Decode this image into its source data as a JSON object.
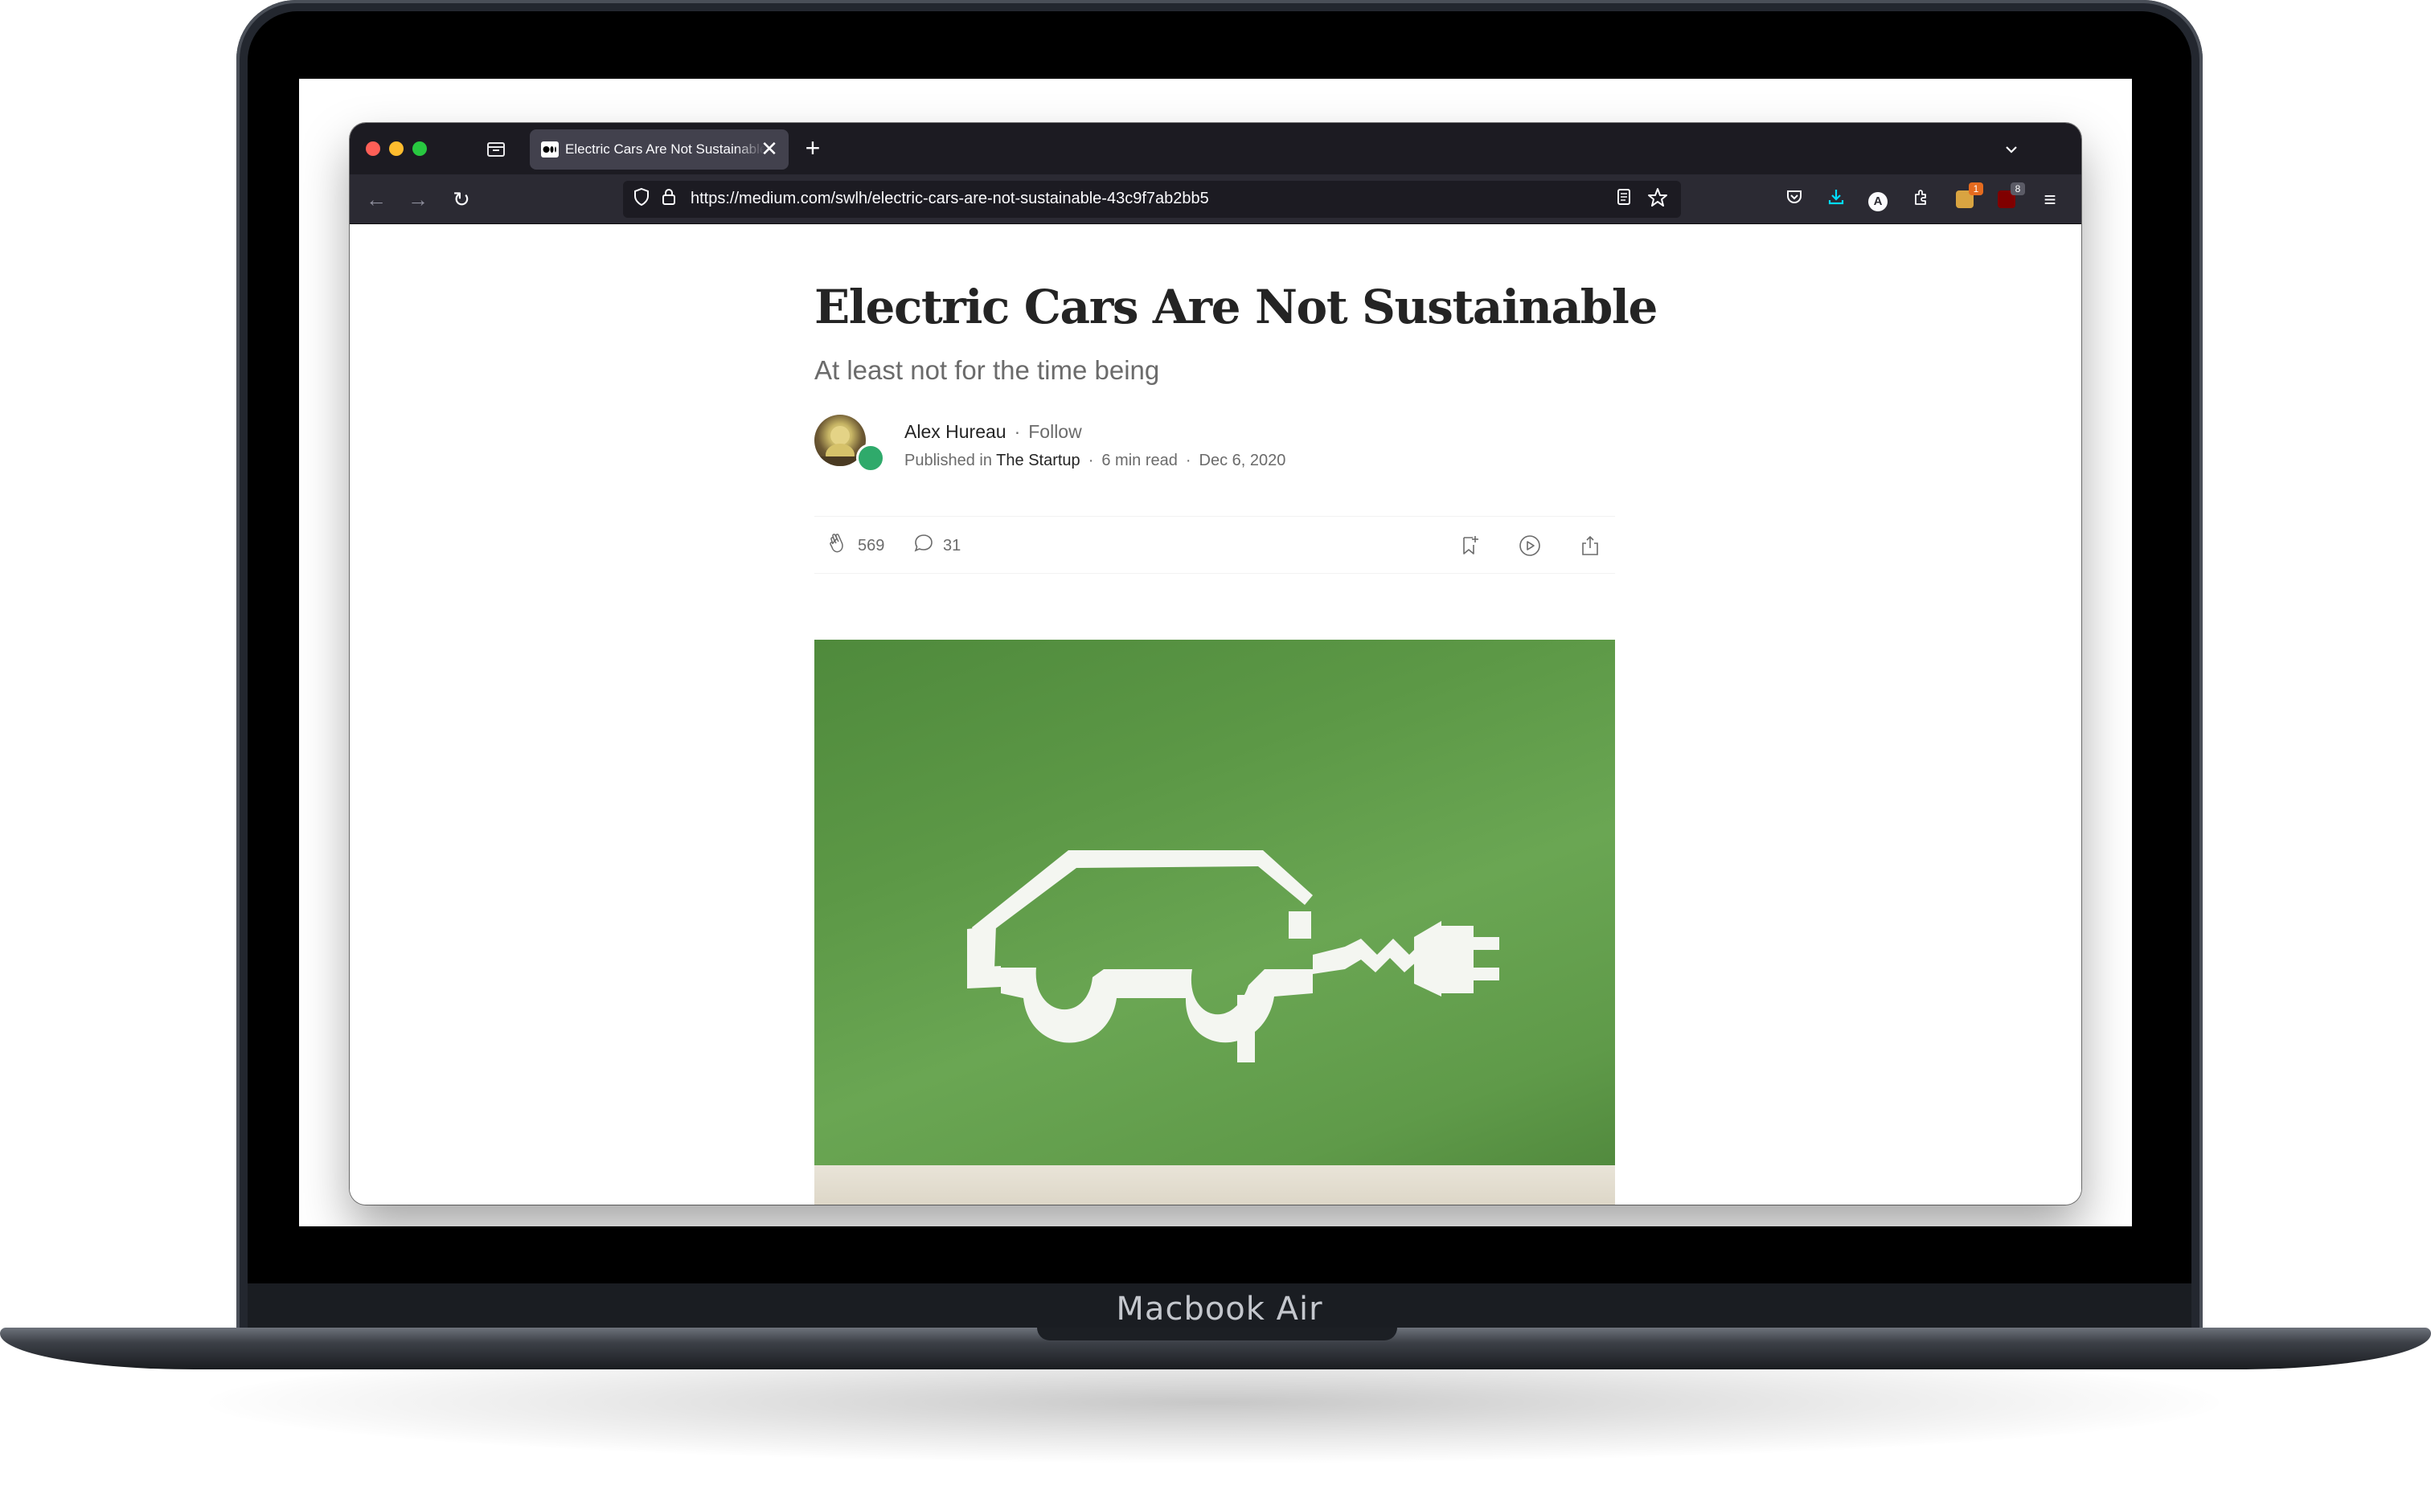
{
  "device": {
    "label": "Macbook Air"
  },
  "browser": {
    "tab": {
      "title": "Electric Cars Are Not Sustainable",
      "close_glyph": "✕"
    },
    "new_tab_glyph": "+",
    "tab_list_glyph": "⌄",
    "nav": {
      "back_glyph": "←",
      "forward_glyph": "→",
      "reload_glyph": "↻"
    },
    "url": "https://medium.com/swlh/electric-cars-are-not-sustainable-43c9f7ab2bb5",
    "toolbar": {
      "account_letter": "A",
      "addon1_badge": "1",
      "addon2_badge": "8",
      "menu_glyph": "≡"
    }
  },
  "article": {
    "title": "Electric Cars Are Not Sustainable",
    "subtitle": "At least not for the time being",
    "author": "Alex Hureau",
    "follow_label": "Follow",
    "published_in_label": "Published in",
    "publication": "The Startup",
    "read_time": "6 min read",
    "date": "Dec 6, 2020",
    "claps": "569",
    "responses": "31"
  },
  "colors": {
    "hero_green": "#5c9846",
    "publication_badge": "#2faa6b",
    "firefox_toolbar": "#2b2a33",
    "firefox_tabbar": "#1c1b22"
  }
}
